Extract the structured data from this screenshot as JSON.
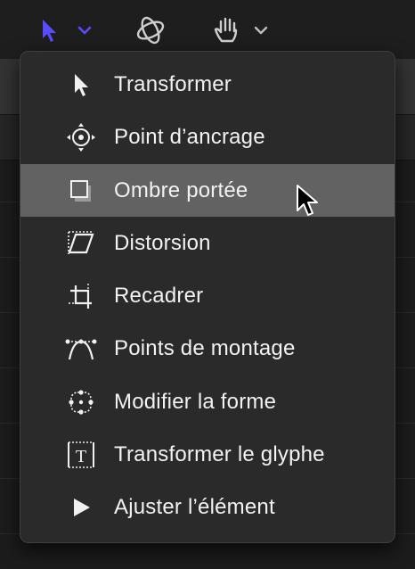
{
  "toolbar": {
    "accent_color": "#5a4bff",
    "tools": [
      {
        "name": "select-transform-tool",
        "icon": "arrow-pointer-icon",
        "has_menu": true
      },
      {
        "name": "3d-transform-tool",
        "icon": "orbit-icon",
        "has_menu": false
      },
      {
        "name": "pan-tool",
        "icon": "hand-icon",
        "has_menu": true
      }
    ]
  },
  "menu": {
    "selected_index": 2,
    "items": [
      {
        "label": "Transformer",
        "icon": "arrow-pointer-icon"
      },
      {
        "label": "Point d’ancrage",
        "icon": "anchor-point-icon"
      },
      {
        "label": "Ombre portée",
        "icon": "drop-shadow-icon"
      },
      {
        "label": "Distorsion",
        "icon": "distort-icon"
      },
      {
        "label": "Recadrer",
        "icon": "crop-icon"
      },
      {
        "label": "Points de montage",
        "icon": "edit-points-icon"
      },
      {
        "label": "Modifier la forme",
        "icon": "adjust-shape-icon"
      },
      {
        "label": "Transformer le glyphe",
        "icon": "transform-glyph-icon"
      },
      {
        "label": "Ajuster l’élément",
        "icon": "adjust-item-icon"
      }
    ]
  }
}
